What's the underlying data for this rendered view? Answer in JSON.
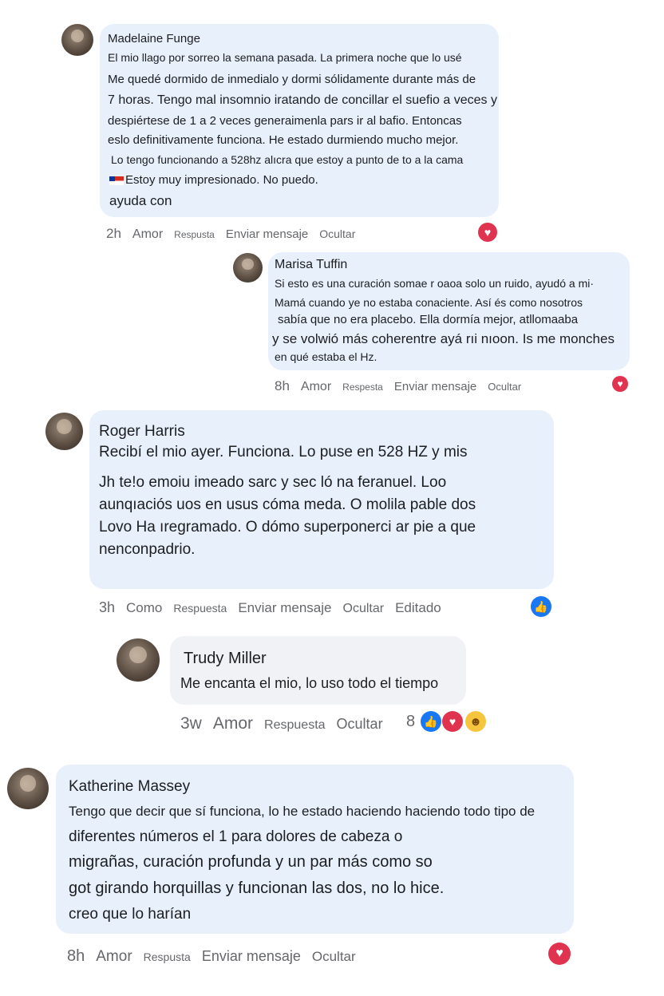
{
  "comments": [
    {
      "author": "Madelaine Funge",
      "lines": [
        "El mio llago por sorreo la semana pasada. La primera noche que lo usé",
        "Me quedé dormido de inmedialo y dormi sólidamente durante más de",
        "7 horas. Tengo mal insomnio iratando de concillar el suefio a veces y",
        "despiértese de 1 a 2 veces generaimenla pars ir al bafio. Entoncas",
        "eslo definitivamente funciona. He estado durmiendo mucho mejor.",
        "Lo tengo funcionando a 528hz alıcra que estoy a punto de to a la cama",
        "Estoy muy impresionado. No puedo.",
        "ayuda con"
      ],
      "time": "2h",
      "actions": [
        "Amor",
        "Respusta",
        "Enviar mensaje",
        "Ocultar"
      ]
    },
    {
      "author": "Marisa Tuffin",
      "lines": [
        "Si esto es una curación somae r oaoa solo un ruido, ayudó a mi·",
        "Mamá cuando ye no estaba conaciente. Así és como nosotros",
        "sabía que no era placebo. Ella dormía mejor, atllomaaba",
        "y se volwió más coherentre ayá rıi nıoon. Is me monches",
        "en qué estaba el Hz."
      ],
      "time": "8h",
      "actions": [
        "Amor",
        "Respesta",
        "Enviar mensaje",
        "Ocultar"
      ]
    },
    {
      "author": "Roger Harris",
      "lines": [
        "Recibí el mio ayer. Funciona. Lo puse en 528 HZ y mis",
        "Jh te!o emoiu imeado sarc y sec ló na feranuel. Loo",
        "aunqıaciós uos en usus cóma meda. O molila pable dos",
        "Lovo Ha ıregramado. O dómo superponerci ar pie a que",
        "nenconpadrio."
      ],
      "time": "3h",
      "actions": [
        "Como",
        "Respuesta",
        "Enviar mensaje",
        "Ocultar",
        "Editado"
      ]
    },
    {
      "author": "Trudy Miller",
      "lines": [
        "Me encanta el mio, lo uso todo el tiempo"
      ],
      "time": "3w",
      "actions": [
        "Amor",
        "Respuesta",
        "Ocultar"
      ],
      "reaction_count": "8"
    },
    {
      "author": "Katherine Massey",
      "lines": [
        "Tengo que decir que sí funciona, lo he estado haciendo haciendo todo tipo de",
        "diferentes números el 1 para dolores de cabeza o",
        "migrañas, curación profunda y un par más como so",
        "got girando horquillas y funcionan las dos, no lo hice.",
        "creo que lo harían"
      ],
      "time": "8h",
      "actions": [
        "Amor",
        "Respusta",
        "Enviar mensaje",
        "Ocultar"
      ]
    }
  ],
  "icons": {
    "heart": "heart-icon",
    "like": "thumbs-up-icon",
    "haha": "laughing-face-icon",
    "flag": "chile-flag-icon"
  },
  "colors": {
    "bubble_blue": "#e7f0fb",
    "bubble_grey": "#f0f2f5",
    "action_text": "#65676b",
    "heart": "#e0334f",
    "like": "#1877f2",
    "haha": "#f7c53d"
  }
}
